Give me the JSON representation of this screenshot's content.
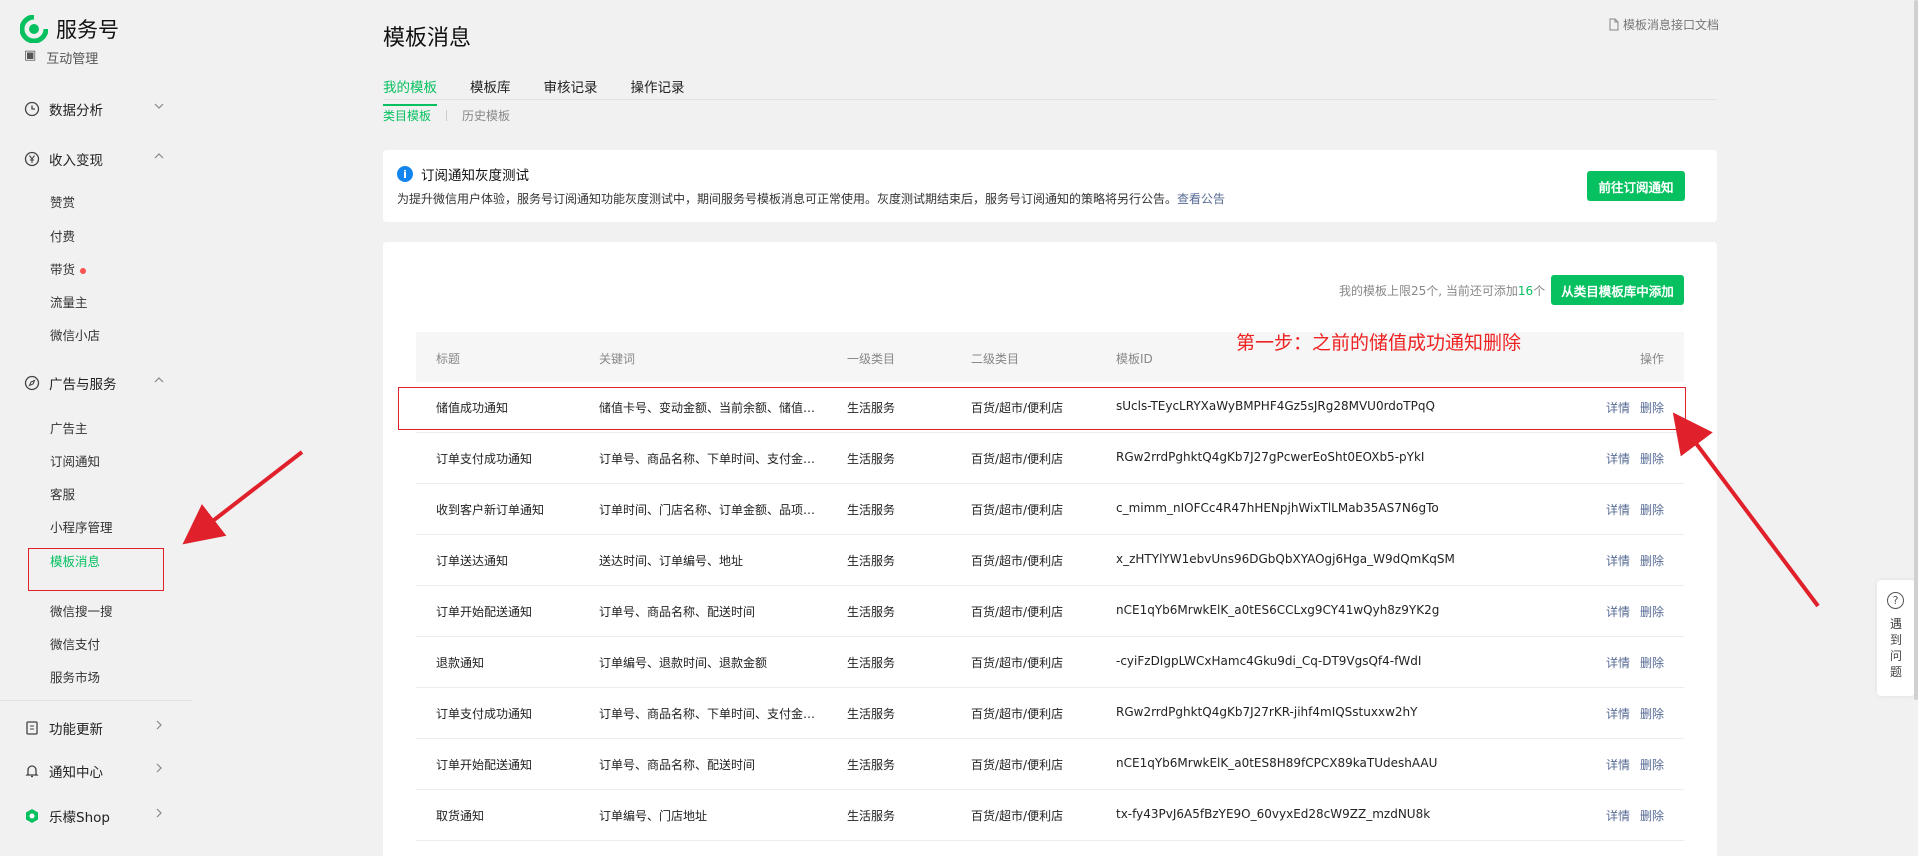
{
  "brand": {
    "name": "服务号",
    "color": "#07c160"
  },
  "sidebar": {
    "cut_item": "互动管理",
    "groups": [
      {
        "label": "数据分析",
        "icon": "clock-icon",
        "expanded": false
      },
      {
        "label": "收入变现",
        "icon": "yen-icon",
        "expanded": true
      },
      {
        "label": "广告与服务",
        "icon": "compass-icon",
        "expanded": true
      },
      {
        "label": "功能更新",
        "icon": "update-icon",
        "expanded": false
      },
      {
        "label": "通知中心",
        "icon": "bell-icon",
        "expanded": false
      },
      {
        "label": "乐檬Shop",
        "icon": "shop-icon",
        "expanded": false
      }
    ],
    "income_items": [
      "赞赏",
      "付费",
      "带货",
      "流量主",
      "微信小店"
    ],
    "service_items": [
      "广告主",
      "订阅通知",
      "客服",
      "小程序管理",
      "模板消息",
      "微信搜一搜",
      "微信支付",
      "服务市场"
    ],
    "active_item": "模板消息"
  },
  "header": {
    "title": "模板消息",
    "doc_link": "模板消息接口文档",
    "tabs": [
      "我的模板",
      "模板库",
      "审核记录",
      "操作记录"
    ],
    "active_tab": "我的模板",
    "subtabs": [
      "类目模板",
      "历史模板"
    ],
    "active_subtab": "类目模板"
  },
  "notice": {
    "title": "订阅通知灰度测试",
    "body": "为提升微信用户体验，服务号订阅通知功能灰度测试中，期间服务号模板消息可正常使用。灰度测试期结束后，服务号订阅通知的策略将另行公告。",
    "link": "查看公告",
    "button": "前往订阅通知"
  },
  "limit": {
    "prefix": "我的模板上限25个, 当前还可添加",
    "count": "16",
    "suffix": "个",
    "button": "从类目模板库中添加"
  },
  "table": {
    "headers": [
      "标题",
      "关键词",
      "一级类目",
      "二级类目",
      "模板ID",
      "操作"
    ],
    "actions": {
      "detail": "详情",
      "delete": "删除"
    },
    "rows": [
      {
        "title": "储值成功通知",
        "keywords": "储值卡号、变动金额、当前余额、储值门店",
        "cat1": "生活服务",
        "cat2": "百货/超市/便利店",
        "id": "sUcls-TEycLRYXaWyBMPHF4Gz5sJRg28MVU0rdoTPqQ"
      },
      {
        "title": "订单支付成功通知",
        "keywords": "订单号、商品名称、下单时间、支付金额、支付方式",
        "cat1": "生活服务",
        "cat2": "百货/超市/便利店",
        "id": "RGw2rrdPghktQ4gKb7J27gPcwerEoSht0EOXb5-pYkI"
      },
      {
        "title": "收到客户新订单通知",
        "keywords": "订单时间、门店名称、订单金额、品项总数",
        "cat1": "生活服务",
        "cat2": "百货/超市/便利店",
        "id": "c_mimm_nIOFCc4R47hHENpjhWixTlLMab35AS7N6gTo"
      },
      {
        "title": "订单送达通知",
        "keywords": "送达时间、订单编号、地址",
        "cat1": "生活服务",
        "cat2": "百货/超市/便利店",
        "id": "x_zHTYlYW1ebvUns96DGbQbXYAOgj6Hga_W9dQmKqSM"
      },
      {
        "title": "订单开始配送通知",
        "keywords": "订单号、商品名称、配送时间",
        "cat1": "生活服务",
        "cat2": "百货/超市/便利店",
        "id": "nCE1qYb6MrwkElK_a0tES6CCLxg9CY41wQyh8z9YK2g"
      },
      {
        "title": "退款通知",
        "keywords": "订单编号、退款时间、退款金额",
        "cat1": "生活服务",
        "cat2": "百货/超市/便利店",
        "id": "-cyiFzDIgpLWCxHamc4Gku9di_Cq-DT9VgsQf4-fWdI"
      },
      {
        "title": "订单支付成功通知",
        "keywords": "订单号、商品名称、下单时间、支付金额、支付方式",
        "cat1": "生活服务",
        "cat2": "百货/超市/便利店",
        "id": "RGw2rrdPghktQ4gKb7J27rKR-jihf4mIQSstuxxw2hY"
      },
      {
        "title": "订单开始配送通知",
        "keywords": "订单号、商品名称、配送时间",
        "cat1": "生活服务",
        "cat2": "百货/超市/便利店",
        "id": "nCE1qYb6MrwkElK_a0tES8H89fCPCX89kaTUdeshAAU"
      },
      {
        "title": "取货通知",
        "keywords": "订单编号、门店地址",
        "cat1": "生活服务",
        "cat2": "百货/超市/便利店",
        "id": "tx-fy43PvJ6A5fBzYE9O_60vyxEd28cW9ZZ_mzdNU8k"
      }
    ]
  },
  "annotation": {
    "text": "第一步：之前的储值成功通知删除",
    "color": "#ee2222"
  },
  "help": {
    "label": "遇到问题"
  }
}
